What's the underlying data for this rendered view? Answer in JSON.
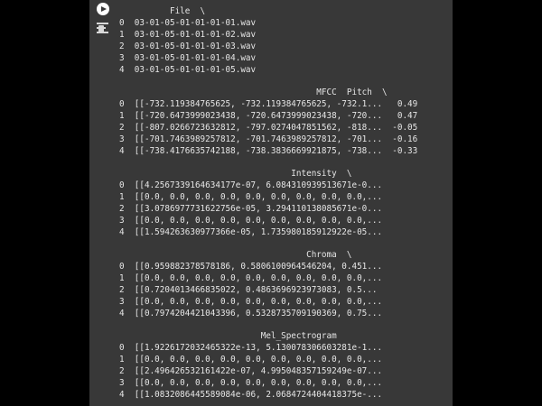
{
  "toolbar": {
    "run_icon": "play-icon",
    "output_icon": "output-options-icon"
  },
  "output": {
    "header_file": "          File  \\",
    "rows_file": [
      "0  03-01-05-01-01-01-01.wav",
      "1  03-01-05-01-01-01-02.wav",
      "2  03-01-05-01-01-01-03.wav",
      "3  03-01-05-01-01-01-04.wav",
      "4  03-01-05-01-01-01-05.wav"
    ],
    "header_mfcc": "                                       MFCC  Pitch  \\",
    "rows_mfcc": [
      "0  [[-732.119384765625, -732.119384765625, -732.1...   0.49",
      "1  [[-720.6473999023438, -720.6473999023438, -720...   0.47",
      "2  [[-807.0266723632812, -797.0274047851562, -818...  -0.05",
      "3  [[-701.7463989257812, -701.7463989257812, -701...  -0.16",
      "4  [[-738.4176635742188, -738.3836669921875, -738...  -0.33"
    ],
    "header_intensity": "                                  Intensity  \\",
    "rows_intensity": [
      "0  [[4.2567339164634177e-07, 6.084310939513671e-0...",
      "1  [[0.0, 0.0, 0.0, 0.0, 0.0, 0.0, 0.0, 0.0, 0.0,...",
      "2  [[3.0786977731622756e-05, 3.294110138085671e-0...",
      "3  [[0.0, 0.0, 0.0, 0.0, 0.0, 0.0, 0.0, 0.0, 0.0,...",
      "4  [[1.594263630977366e-05, 1.735980185912922e-05..."
    ],
    "header_chroma": "                                     Chroma  \\",
    "rows_chroma": [
      "0  [[0.959882378578186, 0.5806100964546204, 0.451...",
      "1  [[0.0, 0.0, 0.0, 0.0, 0.0, 0.0, 0.0, 0.0, 0.0,...",
      "2  [[0.7204013466835022, 0.4863696923973083, 0.5...",
      "3  [[0.0, 0.0, 0.0, 0.0, 0.0, 0.0, 0.0, 0.0, 0.0,...",
      "4  [[0.7974204421043396, 0.5328735709190369, 0.75..."
    ],
    "header_mel": "                            Mel_Spectrogram",
    "rows_mel": [
      "0  [[1.9226172032465322e-13, 5.130078306603281e-1...",
      "1  [[0.0, 0.0, 0.0, 0.0, 0.0, 0.0, 0.0, 0.0, 0.0,...",
      "2  [[2.496426532161422e-07, 4.995048357159249e-07...",
      "3  [[0.0, 0.0, 0.0, 0.0, 0.0, 0.0, 0.0, 0.0, 0.0,...",
      "4  [[1.0832086445589084e-06, 2.0684724404418375e-..."
    ]
  }
}
